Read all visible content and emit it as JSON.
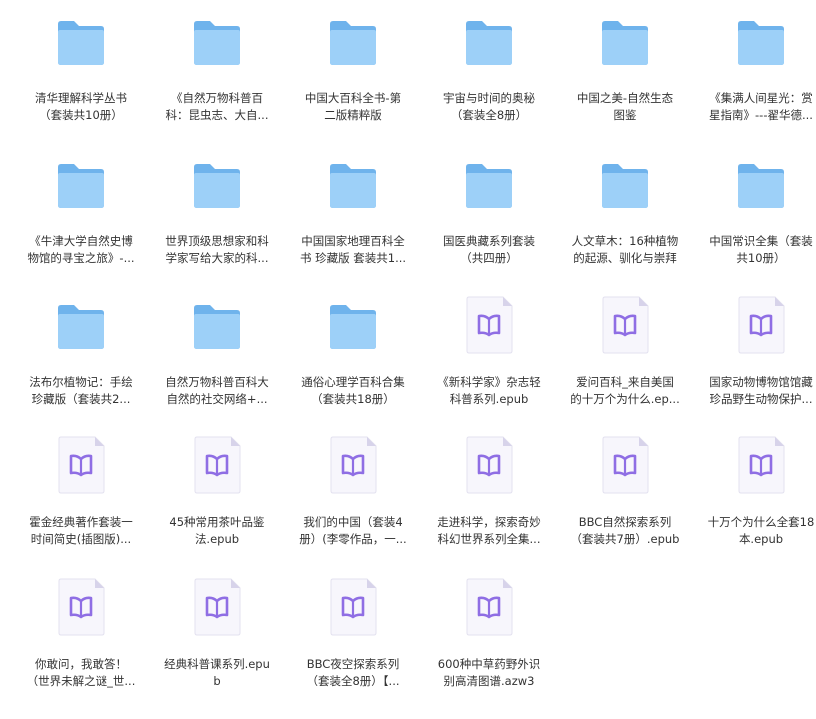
{
  "colors": {
    "folder_back": "#6fb3ec",
    "folder_front": "#9dd0f8",
    "epub_page": "#f7f6fc",
    "epub_border": "#e3e1ef",
    "epub_fold": "#d7d3ea",
    "epub_book": "#8f6ee4",
    "text": "#333333"
  },
  "items": [
    {
      "type": "folder",
      "line1": "清华理解科学丛书",
      "line2": "（套装共10册）"
    },
    {
      "type": "folder",
      "line1": "《自然万物科普百",
      "line2": "科：昆虫志、大自..."
    },
    {
      "type": "folder",
      "line1": "中国大百科全书-第",
      "line2": "二版精粹版"
    },
    {
      "type": "folder",
      "line1": "宇宙与时间的奥秘",
      "line2": "（套装全8册）"
    },
    {
      "type": "folder",
      "line1": "中国之美-自然生态",
      "line2": "图鉴"
    },
    {
      "type": "folder",
      "line1": "《集满人间星光：赏",
      "line2": "星指南》---翟华德..."
    },
    {
      "type": "folder",
      "line1": "《牛津大学自然史博",
      "line2": "物馆的寻宝之旅》-..."
    },
    {
      "type": "folder",
      "line1": "世界顶级思想家和科",
      "line2": "学家写给大家的科..."
    },
    {
      "type": "folder",
      "line1": "中国国家地理百科全",
      "line2": "书 珍藏版 套装共1..."
    },
    {
      "type": "folder",
      "line1": "国医典藏系列套装",
      "line2": "（共四册）"
    },
    {
      "type": "folder",
      "line1": "人文草木：16种植物",
      "line2": "的起源、驯化与崇拜"
    },
    {
      "type": "folder",
      "line1": "中国常识全集（套装",
      "line2": "共10册）"
    },
    {
      "type": "folder",
      "line1": "法布尔植物记：手绘",
      "line2": "珍藏版（套装共2..."
    },
    {
      "type": "folder",
      "line1": "自然万物科普百科大",
      "line2": "自然的社交网络+..."
    },
    {
      "type": "folder",
      "line1": "通俗心理学百科合集",
      "line2": "（套装共18册）"
    },
    {
      "type": "epub",
      "line1": "《新科学家》杂志轻",
      "line2": "科普系列.epub"
    },
    {
      "type": "epub",
      "line1": "爱问百科_来自美国",
      "line2": "的十万个为什么.ep..."
    },
    {
      "type": "epub",
      "line1": "国家动物博物馆馆藏",
      "line2": "珍品野生动物保护..."
    },
    {
      "type": "epub",
      "line1": "霍金经典著作套装一",
      "line2": "时间简史(插图版)..."
    },
    {
      "type": "epub",
      "line1": "45种常用茶叶品鉴",
      "line2": "法.epub"
    },
    {
      "type": "epub",
      "line1": "我们的中国（套装4",
      "line2": "册）(李零作品，一..."
    },
    {
      "type": "epub",
      "line1": "走进科学，探索奇妙",
      "line2": "科幻世界系列全集..."
    },
    {
      "type": "epub",
      "line1": "BBC自然探索系列",
      "line2": "（套装共7册）.epub"
    },
    {
      "type": "epub",
      "line1": "十万个为什么全套18",
      "line2": "本.epub"
    },
    {
      "type": "epub",
      "line1": "你敢问，我敢答！",
      "line2": "（世界未解之谜_世..."
    },
    {
      "type": "epub",
      "line1": "经典科普课系列.epu",
      "line2": "b"
    },
    {
      "type": "epub",
      "line1": "BBC夜空探索系列",
      "line2": "（套装全8册）【..."
    },
    {
      "type": "epub",
      "line1": "600种中草药野外识",
      "line2": "别高清图谱.azw3"
    }
  ]
}
